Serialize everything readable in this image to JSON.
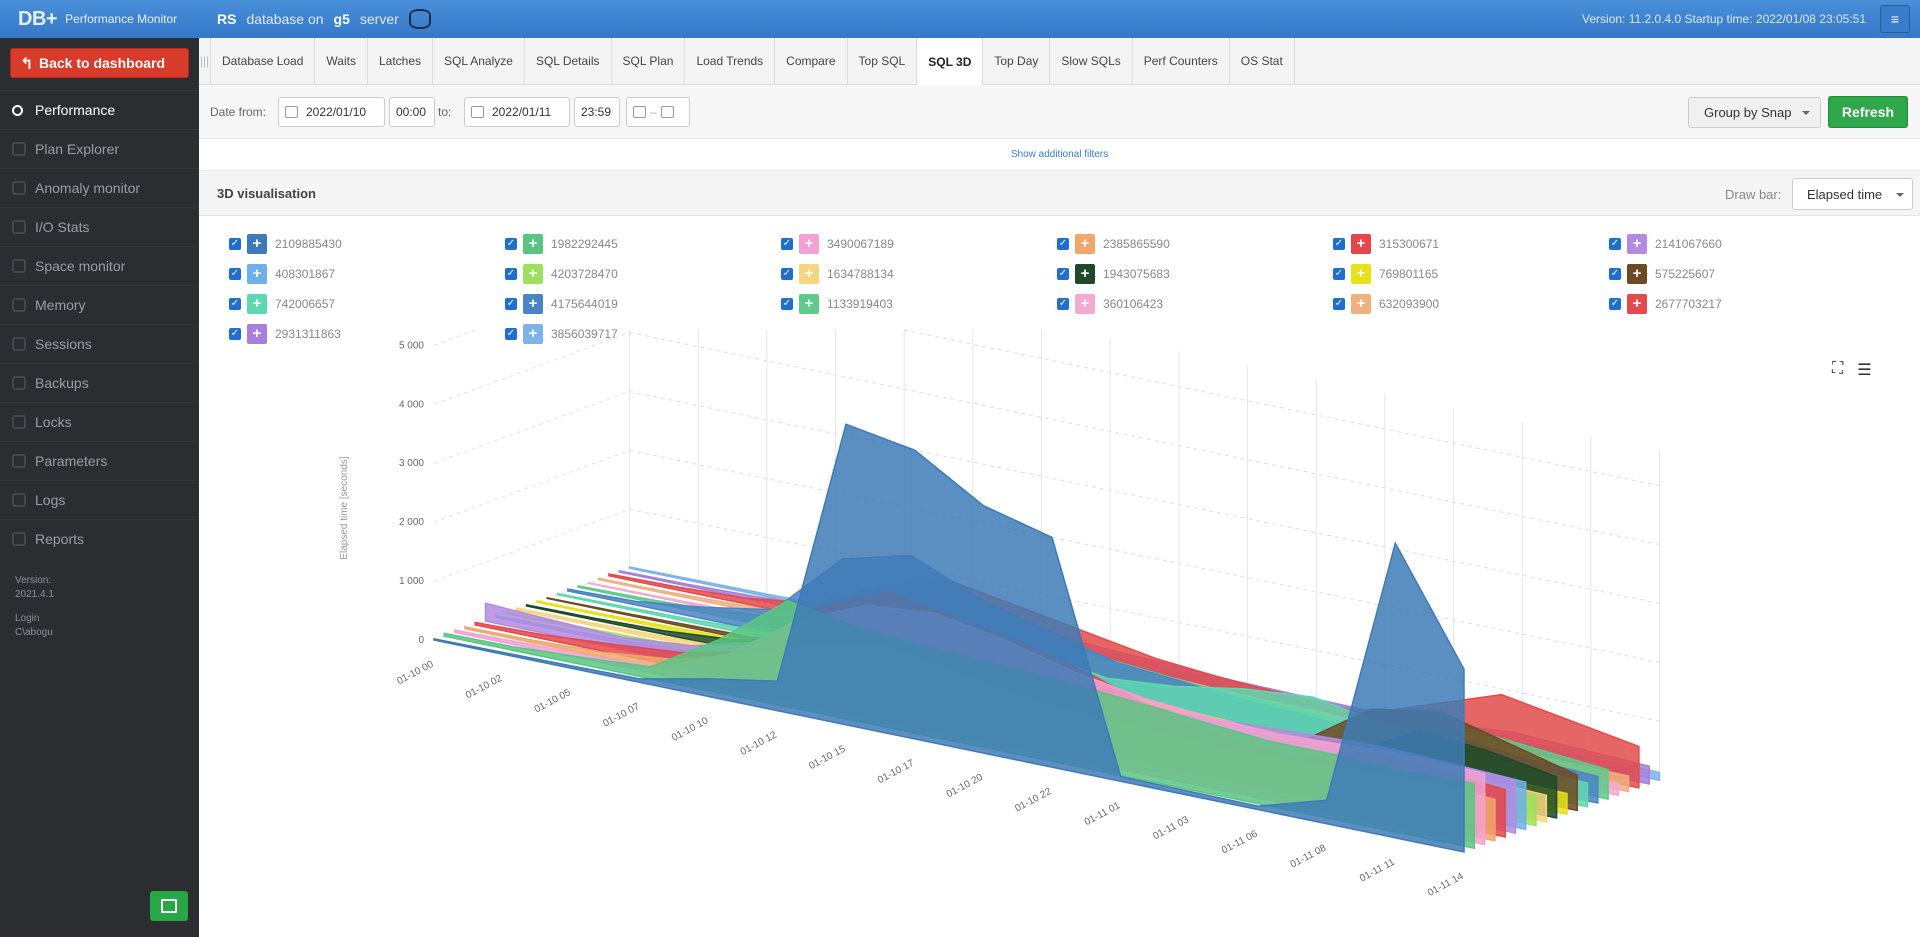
{
  "app": {
    "logo": "DB+",
    "title": "Performance Monitor",
    "db_short": "RS",
    "db_text": "database on",
    "server_name": "g5",
    "server_word": "server",
    "version_info": "Version: 11.2.0.4.0  Startup time: 2022/01/08 23:05:51"
  },
  "sidebar": {
    "back_label": "Back to dashboard",
    "items": [
      {
        "label": "Performance",
        "icon": "stopwatch-icon",
        "active": true
      },
      {
        "label": "Plan Explorer",
        "icon": "plan-icon"
      },
      {
        "label": "Anomaly monitor",
        "icon": "book-icon"
      },
      {
        "label": "I/O Stats",
        "icon": "io-icon"
      },
      {
        "label": "Space monitor",
        "icon": "database-icon"
      },
      {
        "label": "Memory",
        "icon": "memory-icon"
      },
      {
        "label": "Sessions",
        "icon": "user-icon"
      },
      {
        "label": "Backups",
        "icon": "backup-icon"
      },
      {
        "label": "Locks",
        "icon": "lock-icon"
      },
      {
        "label": "Parameters",
        "icon": "parameters-icon"
      },
      {
        "label": "Logs",
        "icon": "logs-icon"
      },
      {
        "label": "Reports",
        "icon": "reports-icon"
      }
    ],
    "version_label": "Version:",
    "version_value": "2021.4.1",
    "login_label": "Login",
    "login_value": "C\\abogu"
  },
  "tabs": [
    "Database Load",
    "Waits",
    "Latches",
    "SQL Analyze",
    "SQL Details",
    "SQL Plan",
    "Load Trends",
    "Compare",
    "Top SQL",
    "SQL 3D",
    "Top Day",
    "Slow SQLs",
    "Perf Counters",
    "OS Stat"
  ],
  "active_tab": "SQL 3D",
  "filters": {
    "date_from_label": "Date from:",
    "date_from": "2022/01/10",
    "time_from": "00:00",
    "to_label": "to:",
    "date_to": "2022/01/11",
    "time_to": "23:59",
    "group_label": "Group by Snap",
    "refresh_label": "Refresh",
    "more_filters": "Show additional filters"
  },
  "panel": {
    "title": "3D visualisation",
    "draw_label": "Draw bar:",
    "draw_value": "Elapsed time"
  },
  "legend": [
    {
      "id": "2109885430",
      "color": "#3e7bb6"
    },
    {
      "id": "1982292445",
      "color": "#5ac582"
    },
    {
      "id": "3490067189",
      "color": "#f2a1d2"
    },
    {
      "id": "2385865590",
      "color": "#f0a76b"
    },
    {
      "id": "315300671",
      "color": "#e5474a"
    },
    {
      "id": "2141067660",
      "color": "#b28be0"
    },
    {
      "id": "408301867",
      "color": "#6db0ea"
    },
    {
      "id": "4203728470",
      "color": "#9ee05d"
    },
    {
      "id": "1634788134",
      "color": "#f6d67d"
    },
    {
      "id": "1943075683",
      "color": "#1f4a2a"
    },
    {
      "id": "769801165",
      "color": "#e8e21a"
    },
    {
      "id": "575225607",
      "color": "#6e4a22"
    },
    {
      "id": "742006657",
      "color": "#5fd7b0"
    },
    {
      "id": "4175644019",
      "color": "#4a84c4"
    },
    {
      "id": "1133919403",
      "color": "#5fca8c"
    },
    {
      "id": "360106423",
      "color": "#f5a9d0"
    },
    {
      "id": "632093900",
      "color": "#f0b080"
    },
    {
      "id": "2677703217",
      "color": "#e24b4b"
    },
    {
      "id": "2931311863",
      "color": "#a77fdc"
    },
    {
      "id": "3856039717",
      "color": "#7cb4ea"
    }
  ],
  "chart_data": {
    "type": "area",
    "ylabel": "Elapsed time [seconds]",
    "yticks": [
      0,
      1000,
      2000,
      3000,
      4000,
      5000
    ],
    "ylim": [
      0,
      5600
    ],
    "x": [
      "01-10 00",
      "01-10 02",
      "01-10 05",
      "01-10 07",
      "01-10 10",
      "01-10 12",
      "01-10 15",
      "01-10 17",
      "01-10 20",
      "01-10 22",
      "01-11 01",
      "01-11 03",
      "01-11 06",
      "01-11 08",
      "01-11 11",
      "01-11 14"
    ],
    "series": [
      {
        "name": "2109885430",
        "values": [
          20,
          30,
          40,
          60,
          300,
          500,
          5100,
          4900,
          4200,
          3900,
          80,
          70,
          60,
          400,
          5000,
          3100
        ]
      },
      {
        "name": "1982292445",
        "values": [
          50,
          60,
          120,
          200,
          900,
          1800,
          1600,
          1500,
          1450,
          1400,
          1300,
          1200,
          1100,
          1100,
          1050,
          1100
        ]
      },
      {
        "name": "3490067189",
        "values": [
          40,
          60,
          80,
          120,
          600,
          1400,
          1900,
          2000,
          1800,
          1500,
          1300,
          1200,
          1150,
          1200,
          1250,
          1200
        ]
      },
      {
        "name": "2385865590",
        "values": [
          30,
          40,
          80,
          200,
          500,
          900,
          1200,
          1000,
          800,
          700,
          650,
          600,
          650,
          700,
          750,
          700
        ]
      },
      {
        "name": "315300671",
        "values": [
          40,
          70,
          150,
          250,
          500,
          1500,
          2000,
          1800,
          1600,
          1300,
          900,
          700,
          600,
          1000,
          900,
          800
        ]
      },
      {
        "name": "2141067660",
        "values": [
          300,
          250,
          200,
          300,
          600,
          900,
          900,
          850,
          800,
          800,
          850,
          900,
          950,
          1000,
          950,
          900
        ]
      },
      {
        "name": "408301867",
        "values": [
          30,
          40,
          60,
          100,
          300,
          700,
          900,
          850,
          800,
          750,
          700,
          650,
          600,
          900,
          850,
          800
        ]
      },
      {
        "name": "4203728470",
        "values": [
          20,
          30,
          50,
          80,
          250,
          600,
          800,
          750,
          700,
          650,
          600,
          550,
          500,
          600,
          550,
          500
        ]
      },
      {
        "name": "1634788134",
        "values": [
          30,
          40,
          60,
          90,
          300,
          600,
          700,
          650,
          600,
          550,
          500,
          450,
          450,
          500,
          500,
          450
        ]
      },
      {
        "name": "1943075683",
        "values": [
          20,
          30,
          60,
          150,
          400,
          1200,
          1000,
          900,
          700,
          500,
          400,
          350,
          400,
          1000,
          900,
          700
        ]
      },
      {
        "name": "769801165",
        "values": [
          20,
          30,
          50,
          80,
          200,
          500,
          600,
          550,
          500,
          450,
          400,
          380,
          360,
          400,
          380,
          350
        ]
      },
      {
        "name": "575225607",
        "values": [
          10,
          20,
          40,
          60,
          150,
          300,
          350,
          300,
          280,
          250,
          230,
          220,
          1000,
          1200,
          900,
          600
        ]
      },
      {
        "name": "742006657",
        "values": [
          20,
          30,
          50,
          100,
          250,
          700,
          900,
          700,
          500,
          600,
          800,
          900,
          700,
          500,
          450,
          400
        ]
      },
      {
        "name": "4175644019",
        "values": [
          30,
          60,
          200,
          400,
          1500,
          1800,
          1300,
          1000,
          700,
          600,
          500,
          450,
          400,
          600,
          500,
          450
        ]
      },
      {
        "name": "1133919403",
        "values": [
          20,
          40,
          80,
          200,
          700,
          1000,
          800,
          700,
          600,
          500,
          450,
          400,
          500,
          700,
          600,
          500
        ]
      },
      {
        "name": "360106423",
        "values": [
          10,
          20,
          40,
          60,
          200,
          400,
          350,
          300,
          250,
          220,
          200,
          190,
          180,
          250,
          230,
          200
        ]
      },
      {
        "name": "632093900",
        "values": [
          20,
          30,
          60,
          100,
          300,
          500,
          450,
          400,
          350,
          300,
          280,
          260,
          250,
          300,
          280,
          260
        ]
      },
      {
        "name": "2677703217",
        "values": [
          30,
          50,
          100,
          250,
          800,
          1100,
          900,
          700,
          500,
          400,
          350,
          300,
          700,
          1100,
          900,
          700
        ]
      },
      {
        "name": "2931311863",
        "values": [
          20,
          30,
          60,
          120,
          350,
          600,
          500,
          400,
          350,
          300,
          280,
          260,
          300,
          400,
          350,
          300
        ]
      },
      {
        "name": "3856039717",
        "values": [
          20,
          30,
          40,
          60,
          150,
          250,
          220,
          200,
          180,
          160,
          150,
          140,
          130,
          150,
          140,
          130
        ]
      }
    ]
  }
}
